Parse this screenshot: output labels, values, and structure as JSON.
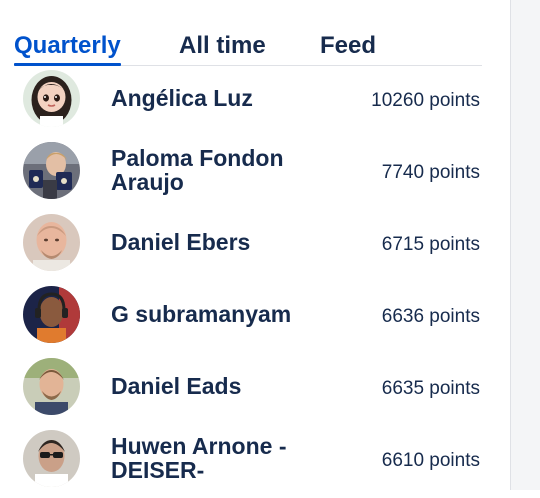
{
  "tabs": [
    {
      "label": "Quarterly",
      "active": true
    },
    {
      "label": "All time",
      "active": false
    },
    {
      "label": "Feed",
      "active": false
    }
  ],
  "leaders": [
    {
      "name": "Angélica Luz",
      "points": "10260 points",
      "avatar": "cartoon-girl-avatar"
    },
    {
      "name": "Paloma Fondon Araujo",
      "points": "7740 points",
      "avatar": "woman-photo-avatar"
    },
    {
      "name": "Daniel Ebers",
      "points": "6715 points",
      "avatar": "man-photo-avatar"
    },
    {
      "name": "G subramanyam",
      "points": "6636 points",
      "avatar": "man-headphones-avatar"
    },
    {
      "name": "Daniel Eads",
      "points": "6635 points",
      "avatar": "man-outdoor-avatar"
    },
    {
      "name": "Huwen Arnone - DEISER-",
      "points": "6610 points",
      "avatar": "man-sunglasses-avatar"
    }
  ],
  "colors": {
    "accent": "#0052cc",
    "text": "#172b4d",
    "divider": "#dfe1e6"
  }
}
